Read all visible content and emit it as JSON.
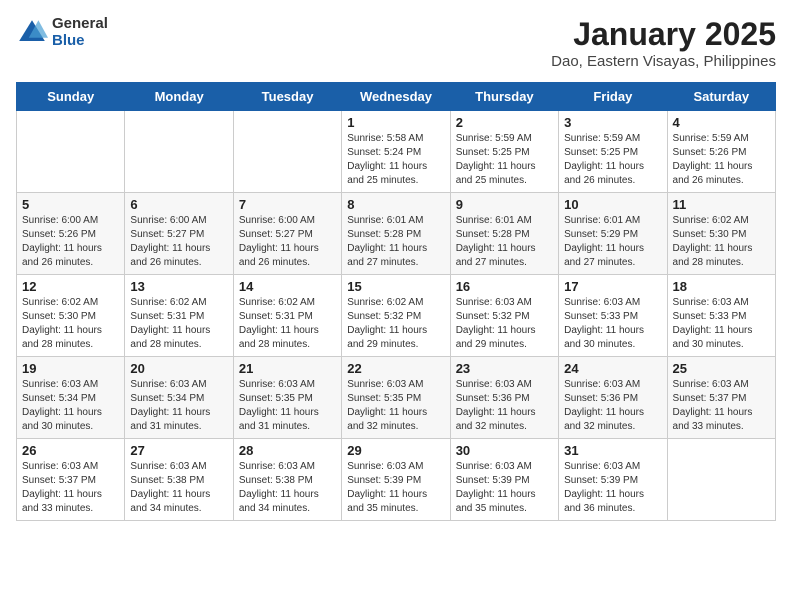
{
  "header": {
    "logo": {
      "general": "General",
      "blue": "Blue"
    },
    "title": "January 2025",
    "subtitle": "Dao, Eastern Visayas, Philippines"
  },
  "weekdays": [
    "Sunday",
    "Monday",
    "Tuesday",
    "Wednesday",
    "Thursday",
    "Friday",
    "Saturday"
  ],
  "weeks": [
    [
      {
        "day": "",
        "info": ""
      },
      {
        "day": "",
        "info": ""
      },
      {
        "day": "",
        "info": ""
      },
      {
        "day": "1",
        "info": "Sunrise: 5:58 AM\nSunset: 5:24 PM\nDaylight: 11 hours\nand 25 minutes."
      },
      {
        "day": "2",
        "info": "Sunrise: 5:59 AM\nSunset: 5:25 PM\nDaylight: 11 hours\nand 25 minutes."
      },
      {
        "day": "3",
        "info": "Sunrise: 5:59 AM\nSunset: 5:25 PM\nDaylight: 11 hours\nand 26 minutes."
      },
      {
        "day": "4",
        "info": "Sunrise: 5:59 AM\nSunset: 5:26 PM\nDaylight: 11 hours\nand 26 minutes."
      }
    ],
    [
      {
        "day": "5",
        "info": "Sunrise: 6:00 AM\nSunset: 5:26 PM\nDaylight: 11 hours\nand 26 minutes."
      },
      {
        "day": "6",
        "info": "Sunrise: 6:00 AM\nSunset: 5:27 PM\nDaylight: 11 hours\nand 26 minutes."
      },
      {
        "day": "7",
        "info": "Sunrise: 6:00 AM\nSunset: 5:27 PM\nDaylight: 11 hours\nand 26 minutes."
      },
      {
        "day": "8",
        "info": "Sunrise: 6:01 AM\nSunset: 5:28 PM\nDaylight: 11 hours\nand 27 minutes."
      },
      {
        "day": "9",
        "info": "Sunrise: 6:01 AM\nSunset: 5:28 PM\nDaylight: 11 hours\nand 27 minutes."
      },
      {
        "day": "10",
        "info": "Sunrise: 6:01 AM\nSunset: 5:29 PM\nDaylight: 11 hours\nand 27 minutes."
      },
      {
        "day": "11",
        "info": "Sunrise: 6:02 AM\nSunset: 5:30 PM\nDaylight: 11 hours\nand 28 minutes."
      }
    ],
    [
      {
        "day": "12",
        "info": "Sunrise: 6:02 AM\nSunset: 5:30 PM\nDaylight: 11 hours\nand 28 minutes."
      },
      {
        "day": "13",
        "info": "Sunrise: 6:02 AM\nSunset: 5:31 PM\nDaylight: 11 hours\nand 28 minutes."
      },
      {
        "day": "14",
        "info": "Sunrise: 6:02 AM\nSunset: 5:31 PM\nDaylight: 11 hours\nand 28 minutes."
      },
      {
        "day": "15",
        "info": "Sunrise: 6:02 AM\nSunset: 5:32 PM\nDaylight: 11 hours\nand 29 minutes."
      },
      {
        "day": "16",
        "info": "Sunrise: 6:03 AM\nSunset: 5:32 PM\nDaylight: 11 hours\nand 29 minutes."
      },
      {
        "day": "17",
        "info": "Sunrise: 6:03 AM\nSunset: 5:33 PM\nDaylight: 11 hours\nand 30 minutes."
      },
      {
        "day": "18",
        "info": "Sunrise: 6:03 AM\nSunset: 5:33 PM\nDaylight: 11 hours\nand 30 minutes."
      }
    ],
    [
      {
        "day": "19",
        "info": "Sunrise: 6:03 AM\nSunset: 5:34 PM\nDaylight: 11 hours\nand 30 minutes."
      },
      {
        "day": "20",
        "info": "Sunrise: 6:03 AM\nSunset: 5:34 PM\nDaylight: 11 hours\nand 31 minutes."
      },
      {
        "day": "21",
        "info": "Sunrise: 6:03 AM\nSunset: 5:35 PM\nDaylight: 11 hours\nand 31 minutes."
      },
      {
        "day": "22",
        "info": "Sunrise: 6:03 AM\nSunset: 5:35 PM\nDaylight: 11 hours\nand 32 minutes."
      },
      {
        "day": "23",
        "info": "Sunrise: 6:03 AM\nSunset: 5:36 PM\nDaylight: 11 hours\nand 32 minutes."
      },
      {
        "day": "24",
        "info": "Sunrise: 6:03 AM\nSunset: 5:36 PM\nDaylight: 11 hours\nand 32 minutes."
      },
      {
        "day": "25",
        "info": "Sunrise: 6:03 AM\nSunset: 5:37 PM\nDaylight: 11 hours\nand 33 minutes."
      }
    ],
    [
      {
        "day": "26",
        "info": "Sunrise: 6:03 AM\nSunset: 5:37 PM\nDaylight: 11 hours\nand 33 minutes."
      },
      {
        "day": "27",
        "info": "Sunrise: 6:03 AM\nSunset: 5:38 PM\nDaylight: 11 hours\nand 34 minutes."
      },
      {
        "day": "28",
        "info": "Sunrise: 6:03 AM\nSunset: 5:38 PM\nDaylight: 11 hours\nand 34 minutes."
      },
      {
        "day": "29",
        "info": "Sunrise: 6:03 AM\nSunset: 5:39 PM\nDaylight: 11 hours\nand 35 minutes."
      },
      {
        "day": "30",
        "info": "Sunrise: 6:03 AM\nSunset: 5:39 PM\nDaylight: 11 hours\nand 35 minutes."
      },
      {
        "day": "31",
        "info": "Sunrise: 6:03 AM\nSunset: 5:39 PM\nDaylight: 11 hours\nand 36 minutes."
      },
      {
        "day": "",
        "info": ""
      }
    ]
  ]
}
